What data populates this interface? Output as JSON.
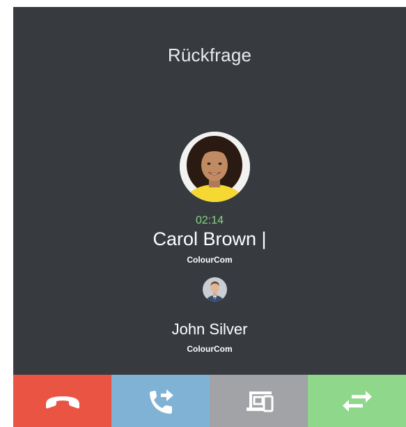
{
  "header": {
    "title": "Rückfrage"
  },
  "active_call": {
    "timer": "02:14",
    "name": "Carol Brown |",
    "company": "ColourCom",
    "avatar_icon": "avatar-woman"
  },
  "held_call": {
    "name": "John Silver",
    "company": "ColourCom",
    "avatar_icon": "avatar-man"
  },
  "actions": [
    {
      "name": "hangup",
      "icon": "phone-hangup-icon",
      "color": "#e95443"
    },
    {
      "name": "transfer",
      "icon": "phone-forward-icon",
      "color": "#7fb2d4"
    },
    {
      "name": "device",
      "icon": "devices-icon",
      "color": "#a1a3a6"
    },
    {
      "name": "swap",
      "icon": "swap-arrows-icon",
      "color": "#8fd78a"
    }
  ],
  "colors": {
    "background": "#373b40",
    "timer": "#86d37f"
  }
}
